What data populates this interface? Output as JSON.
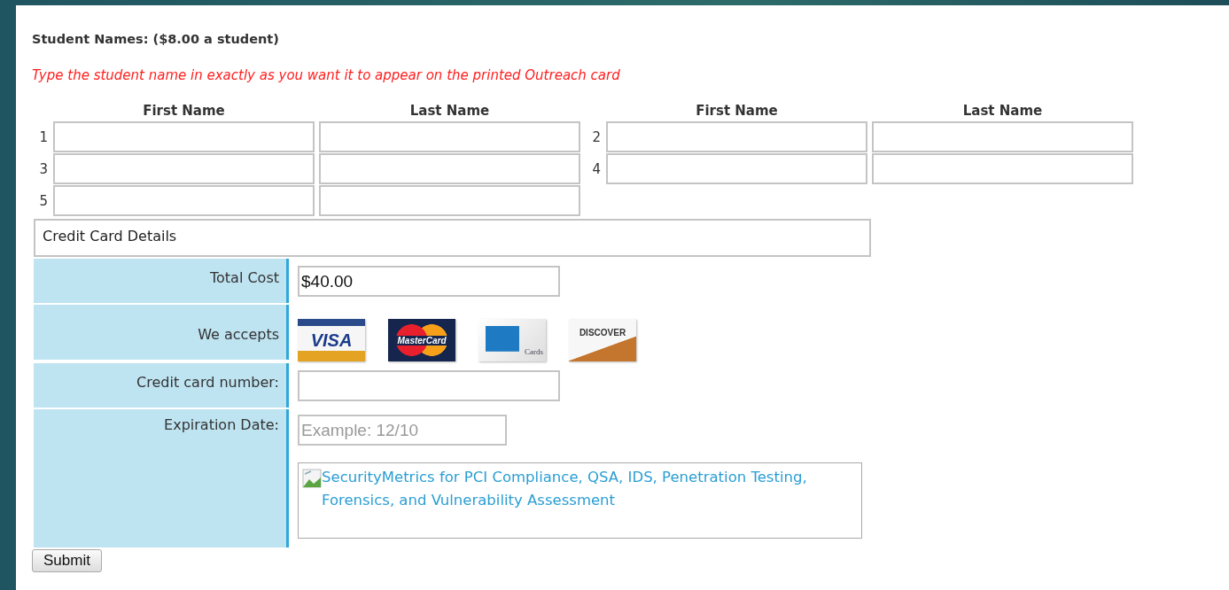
{
  "heading": "Student Names: ($8.00 a student)",
  "instruction": "Type the student name in exactly as you want it to appear on the printed Outreach card",
  "column_headers": [
    "First Name",
    "Last Name",
    "First Name",
    "Last Name"
  ],
  "students": [
    {
      "number": "1"
    },
    {
      "number": "2"
    },
    {
      "number": "3"
    },
    {
      "number": "4"
    },
    {
      "number": "5"
    }
  ],
  "credit_card": {
    "title": "Credit Card Details",
    "rows": [
      {
        "kind": "input",
        "label": "Total Cost",
        "value": "$40.00"
      },
      {
        "kind": "cards",
        "label": "We accepts",
        "cards": [
          {
            "kind": "visa",
            "text": "VISA"
          },
          {
            "kind": "mastercard",
            "text": "MasterCard"
          },
          {
            "kind": "amex",
            "text": "Cards"
          },
          {
            "kind": "discover",
            "text": "DISCOVER"
          }
        ]
      },
      {
        "kind": "input",
        "label": "Credit card number:"
      },
      {
        "kind": "expiry",
        "label": "Expiration Date:",
        "placeholder": "Example: 12/10",
        "seal_text": "SecurityMetrics for PCI Compliance, QSA, IDS, Penetration Testing, Forensics, and Vulnerability Assessment"
      }
    ]
  },
  "submit": "Submit"
}
